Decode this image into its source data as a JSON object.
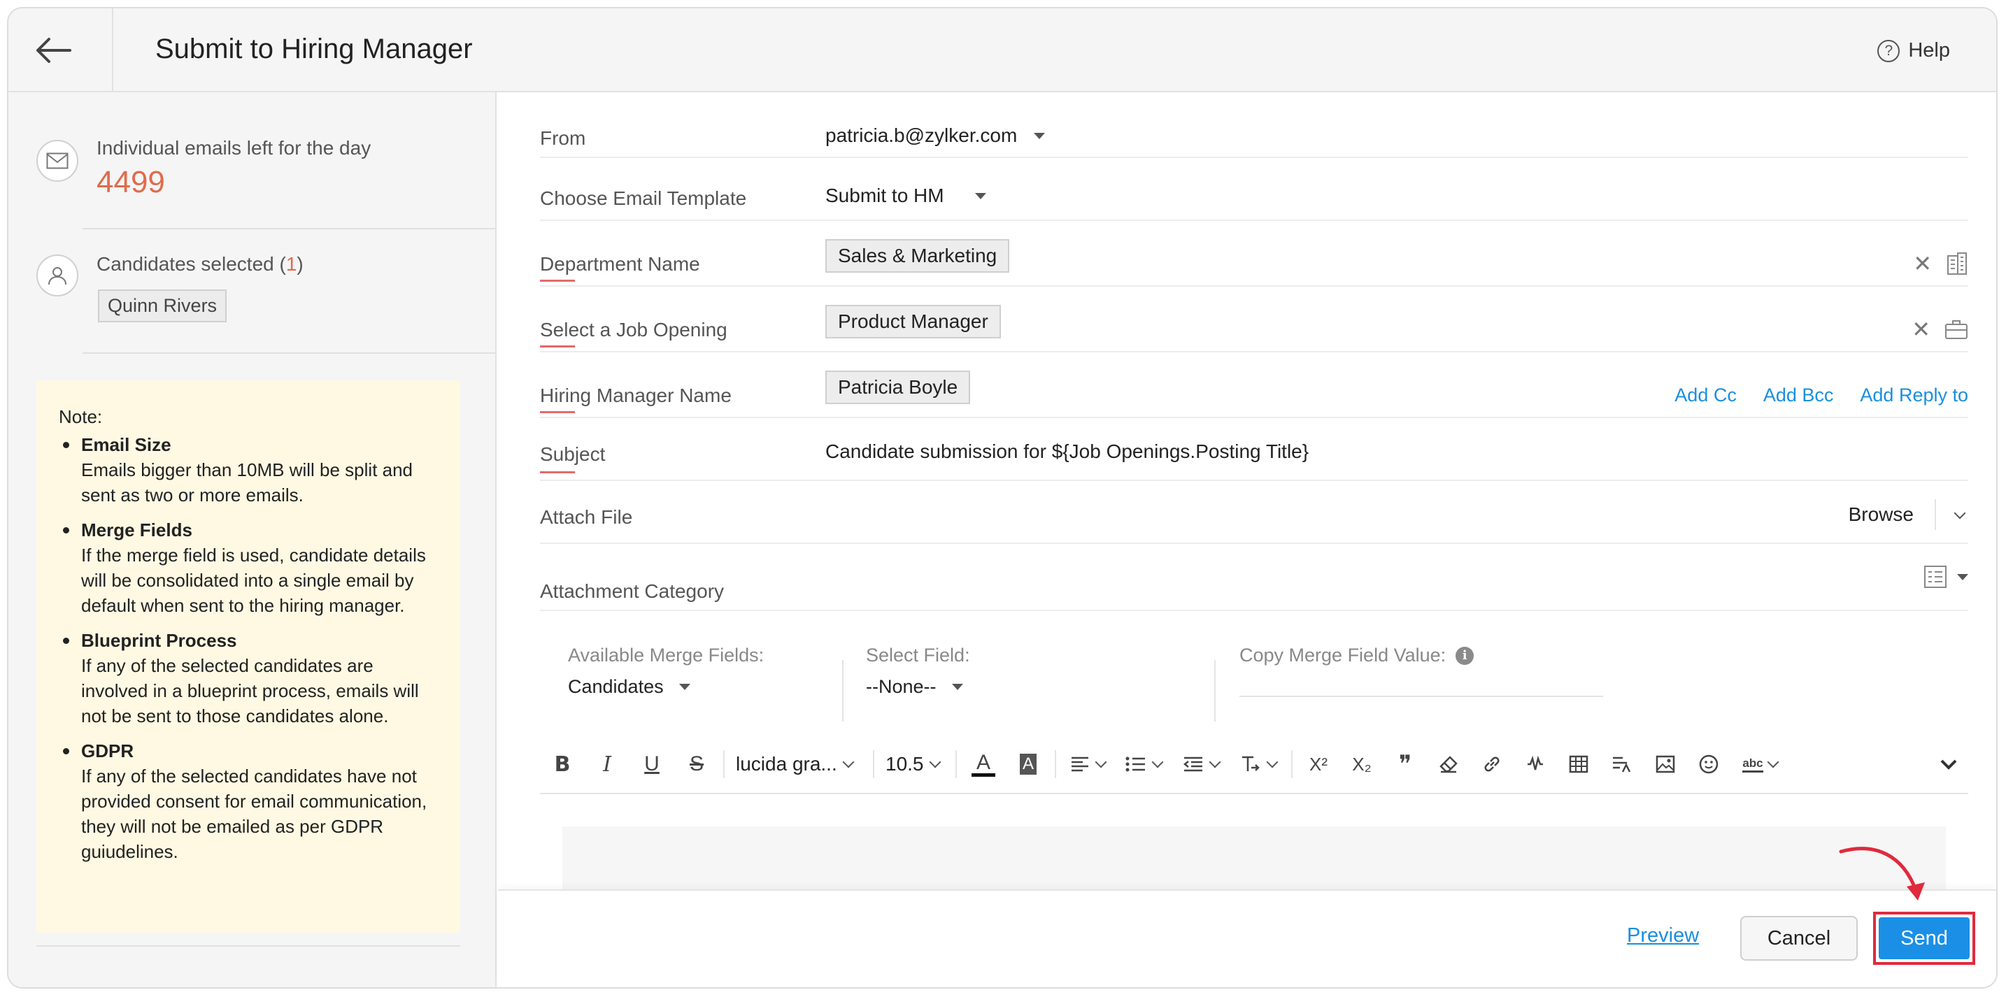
{
  "header": {
    "title": "Submit to Hiring Manager",
    "help_label": "Help",
    "help_icon_glyph": "?"
  },
  "sidebar": {
    "emails_left_label": "Individual emails left for the day",
    "emails_left_count": "4499",
    "candidates_label_prefix": "Candidates selected (",
    "candidates_count": "1",
    "candidates_label_suffix": ")",
    "candidate_name": "Quinn Rivers",
    "note": {
      "title": "Note:",
      "items": [
        {
          "heading": "Email Size",
          "text": "Emails bigger than 10MB will be split and sent as two or more emails."
        },
        {
          "heading": "Merge Fields",
          "text": "If the merge field is used, candidate details will be consolidated into a single email by default when sent to the hiring manager."
        },
        {
          "heading": "Blueprint Process",
          "text": "If any of the selected candidates are involved in a blueprint process, emails will not be sent to those candidates alone."
        },
        {
          "heading": "GDPR",
          "text": "If any of the selected candidates have not provided consent for email communication, they will not be emailed as per GDPR guiudelines."
        }
      ]
    }
  },
  "form": {
    "from": {
      "label": "From",
      "value": "patricia.b@zylker.com"
    },
    "template": {
      "label": "Choose Email Template",
      "value": "Submit to HM"
    },
    "department": {
      "label": "Department Name",
      "value": "Sales & Marketing"
    },
    "job_opening": {
      "label": "Select a Job Opening",
      "value": "Product Manager"
    },
    "hiring_manager": {
      "label": "Hiring Manager Name",
      "value": "Patricia Boyle"
    },
    "links": {
      "add_cc": "Add Cc",
      "add_bcc": "Add Bcc",
      "add_reply_to": "Add Reply to"
    },
    "subject": {
      "label": "Subject",
      "value": "Candidate submission for ${Job Openings.Posting Title}"
    },
    "attach": {
      "label": "Attach File",
      "browse": "Browse"
    },
    "attachment_category": {
      "label": "Attachment Category"
    },
    "clear_glyph": "✕"
  },
  "merge": {
    "available_label": "Available Merge Fields:",
    "available_value": "Candidates",
    "select_label": "Select Field:",
    "select_value": "--None--",
    "copy_label": "Copy Merge Field Value:",
    "info_glyph": "i"
  },
  "toolbar": {
    "bold": "B",
    "italic": "I",
    "underline": "U",
    "strike": "S",
    "font_family": "lucida gra...",
    "font_size": "10.5",
    "font_color": "A",
    "bg_color": "A",
    "superscript": "X²",
    "subscript": "X₂",
    "quote": "❞",
    "spellcheck": "abc"
  },
  "footer": {
    "preview": "Preview",
    "cancel": "Cancel",
    "send": "Send"
  },
  "colors": {
    "accent": "#1b8fe6",
    "link": "#1a8fdc",
    "count": "#e06c4c",
    "highlight": "#e02a3d"
  }
}
